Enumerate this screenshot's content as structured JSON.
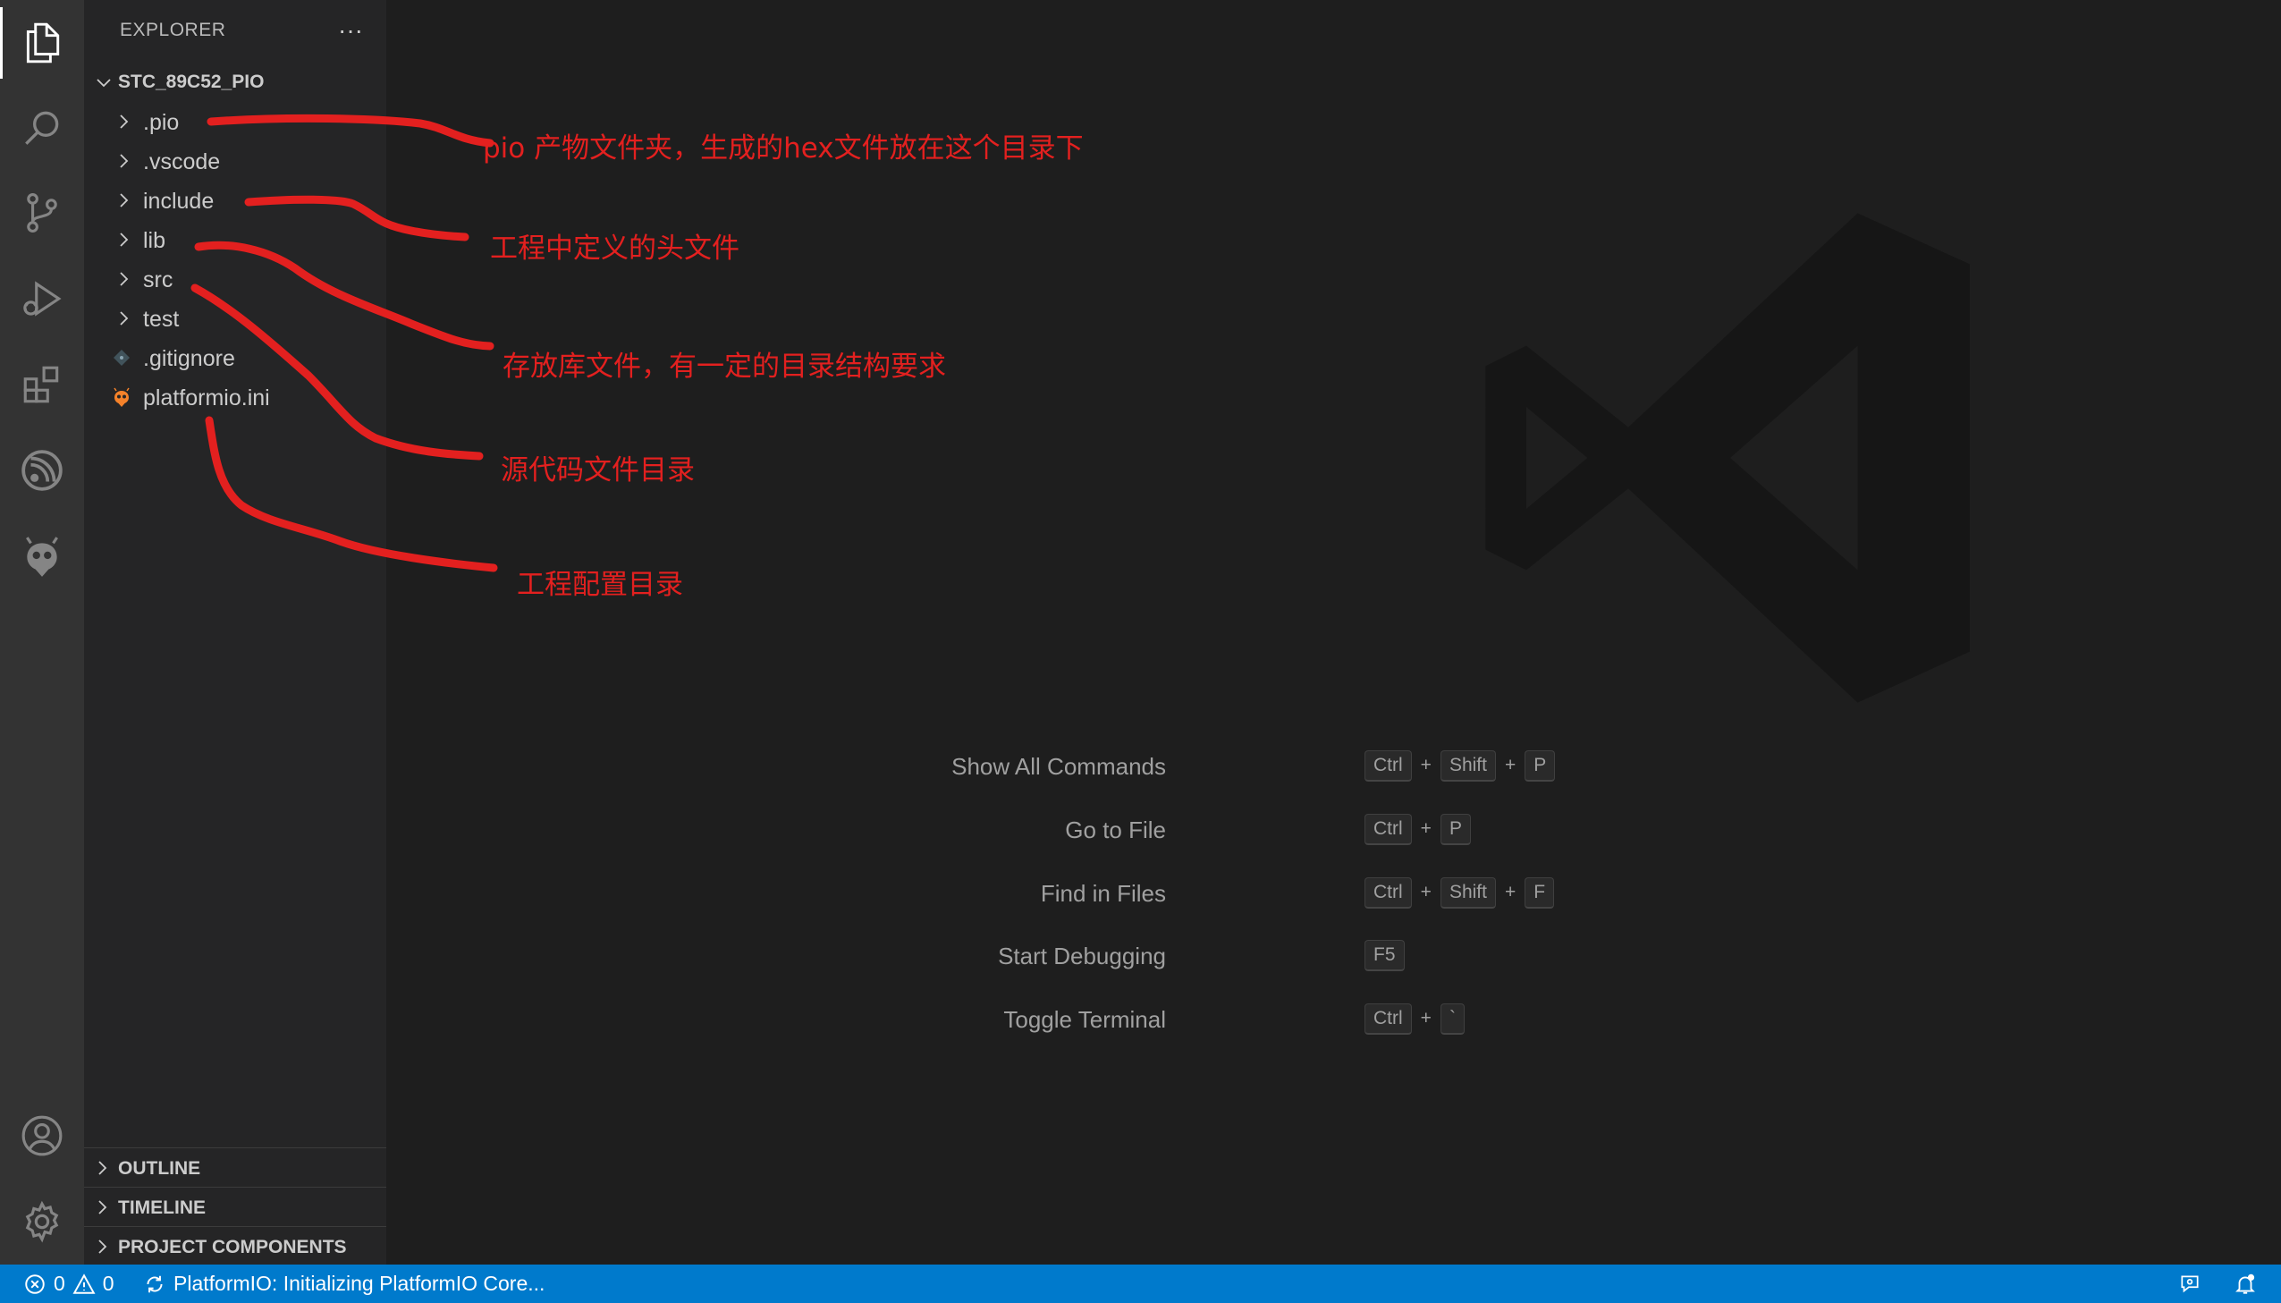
{
  "activity_bar": {
    "items": [
      {
        "icon": "files-icon",
        "active": true
      },
      {
        "icon": "search-icon"
      },
      {
        "icon": "source-control-icon"
      },
      {
        "icon": "run-debug-icon"
      },
      {
        "icon": "extensions-icon"
      },
      {
        "icon": "espressif-icon"
      },
      {
        "icon": "platformio-icon"
      }
    ],
    "bottom": [
      {
        "icon": "account-icon"
      },
      {
        "icon": "settings-gear-icon"
      }
    ]
  },
  "sidebar": {
    "title": "EXPLORER",
    "more_label": "···",
    "root": "STC_89C52_PIO",
    "tree": [
      {
        "label": ".pio",
        "type": "folder"
      },
      {
        "label": ".vscode",
        "type": "folder"
      },
      {
        "label": "include",
        "type": "folder"
      },
      {
        "label": "lib",
        "type": "folder"
      },
      {
        "label": "src",
        "type": "folder"
      },
      {
        "label": "test",
        "type": "folder"
      },
      {
        "label": ".gitignore",
        "type": "file",
        "icon": "git-file-icon"
      },
      {
        "label": "platformio.ini",
        "type": "file",
        "icon": "platformio-file-icon"
      }
    ],
    "panels": [
      "OUTLINE",
      "TIMELINE",
      "PROJECT COMPONENTS"
    ]
  },
  "editor": {
    "shortcuts": [
      {
        "label": "Show All Commands",
        "keys": [
          "Ctrl",
          "Shift",
          "P"
        ]
      },
      {
        "label": "Go to File",
        "keys": [
          "Ctrl",
          "P"
        ]
      },
      {
        "label": "Find in Files",
        "keys": [
          "Ctrl",
          "Shift",
          "F"
        ]
      },
      {
        "label": "Start Debugging",
        "keys": [
          "F5"
        ]
      },
      {
        "label": "Toggle Terminal",
        "keys": [
          "Ctrl",
          "`"
        ]
      }
    ]
  },
  "annotations": [
    "pio 产物文件夹，生成的hex文件放在这个目录下",
    "工程中定义的头文件",
    "存放库文件，有一定的目录结构要求",
    "源代码文件目录",
    "工程配置目录"
  ],
  "status_bar": {
    "errors": "0",
    "warnings": "0",
    "message": "PlatformIO: Initializing PlatformIO Core..."
  },
  "colors": {
    "accent": "#007acc",
    "annotation": "#e3201f"
  }
}
